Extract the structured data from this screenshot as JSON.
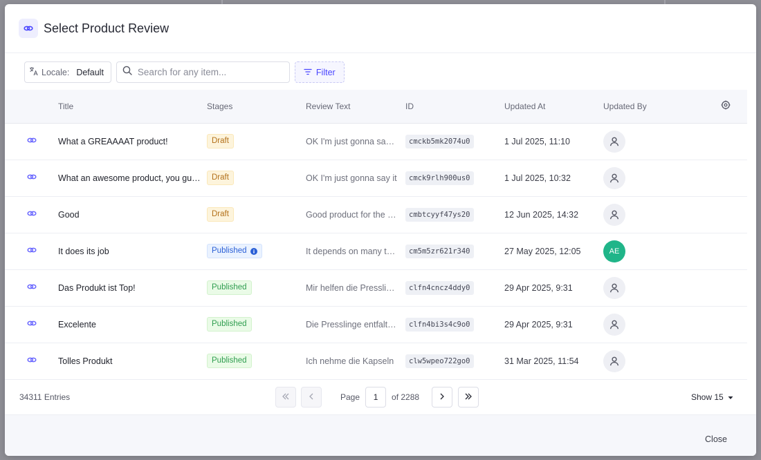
{
  "modal": {
    "title": "Select Product Review"
  },
  "toolbar": {
    "locale_label": "Locale:",
    "locale_value": "Default",
    "search_placeholder": "Search for any item...",
    "search_value": "",
    "filter_label": "Filter"
  },
  "table": {
    "columns": {
      "title": "Title",
      "stages": "Stages",
      "review_text": "Review Text",
      "id": "ID",
      "updated_at": "Updated At",
      "updated_by": "Updated By"
    },
    "rows": [
      {
        "title": "What a GREAAAAT product!",
        "stage": "Draft",
        "text": "OK I'm just gonna say it, this is the best product ever",
        "id": "cmckb5mk2074u0",
        "updated": "1 Jul 2025, 11:10",
        "by": ""
      },
      {
        "title": "What an awesome product, you guys rock",
        "stage": "Draft",
        "text": "OK I'm just gonna say it",
        "id": "cmck9rlh900us0",
        "updated": "1 Jul 2025, 10:32",
        "by": ""
      },
      {
        "title": "Good",
        "stage": "Draft",
        "text": "Good product for the price",
        "id": "cmbtcyyf47ys20",
        "updated": "12 Jun 2025, 14:32",
        "by": ""
      },
      {
        "title": "It does its job",
        "stage": "Published",
        "text": "It depends on many things",
        "id": "cm5m5zr621r340",
        "updated": "27 May 2025, 12:05",
        "by": "AE"
      },
      {
        "title": "Das Produkt ist Top!",
        "stage": "Published",
        "text": "Mir helfen die Presslinge",
        "id": "clfn4cncz4ddy0",
        "updated": "29 Apr 2025, 9:31",
        "by": ""
      },
      {
        "title": "Excelente",
        "stage": "Published",
        "text": "Die Presslinge entfalten",
        "id": "clfn4bi3s4c9o0",
        "updated": "29 Apr 2025, 9:31",
        "by": ""
      },
      {
        "title": "Tolles Produkt",
        "stage": "Published",
        "text": "Ich nehme die Kapseln",
        "id": "clw5wpeo722go0",
        "updated": "31 Mar 2025, 11:54",
        "by": ""
      }
    ]
  },
  "pagination": {
    "entries": "34311 Entries",
    "page_label": "Page",
    "current_page": "1",
    "of_label": "of 2288",
    "show_label": "Show 15"
  },
  "footer": {
    "close_label": "Close"
  },
  "colors": {
    "accent": "#4945ff",
    "draft": "#b3701a",
    "published": "#2f9d4f",
    "avatar_initials_bg": "#20b589"
  }
}
